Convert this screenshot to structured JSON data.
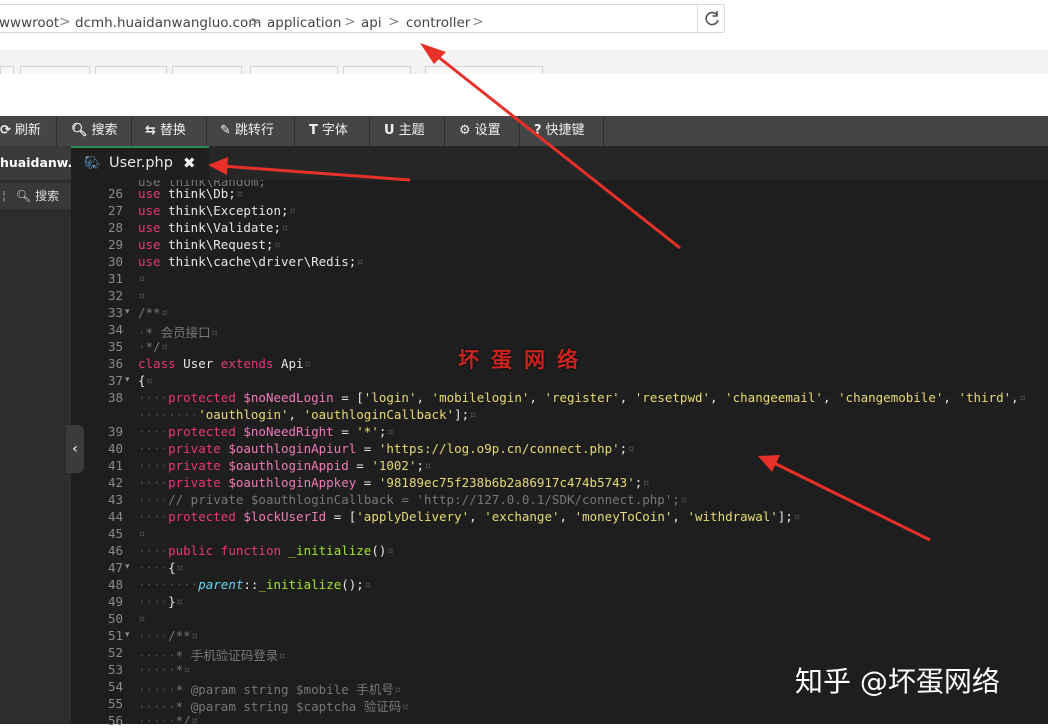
{
  "breadcrumb": {
    "items": [
      "wwwroot",
      "dcmh.huaidanwangluo.com",
      "application",
      "api",
      "controller"
    ],
    "separator": ">"
  },
  "toolbar": {
    "items": [
      {
        "icon": "refresh-icon",
        "label": "刷新"
      },
      {
        "icon": "search-icon",
        "label": "搜索"
      },
      {
        "icon": "replace-icon",
        "label": "替换"
      },
      {
        "icon": "pin-icon",
        "label": "跳转行"
      },
      {
        "icon": "font-icon",
        "label": "字体"
      },
      {
        "icon": "theme-icon",
        "label": "主题"
      },
      {
        "icon": "gear-icon",
        "label": "设置"
      },
      {
        "icon": "help-icon",
        "label": "快捷键"
      }
    ]
  },
  "sidebar": {
    "tab_label": "huaidanw...",
    "search_label": "搜索"
  },
  "editor": {
    "file_tab": "User.php",
    "lines": [
      {
        "n": "26",
        "text": "use think\\Db;"
      },
      {
        "n": "27",
        "text": "use think\\Exception;"
      },
      {
        "n": "28",
        "text": "use think\\Validate;"
      },
      {
        "n": "29",
        "text": "use think\\Request;"
      },
      {
        "n": "30",
        "text": "use think\\cache\\driver\\Redis;"
      },
      {
        "n": "31",
        "text": ""
      },
      {
        "n": "32",
        "text": ""
      },
      {
        "n": "33",
        "text": "/**"
      },
      {
        "n": "34",
        "text": " * 会员接口"
      },
      {
        "n": "35",
        "text": " */"
      },
      {
        "n": "36",
        "text": "class User extends Api"
      },
      {
        "n": "37",
        "text": "{"
      },
      {
        "n": "38",
        "text": "    protected $noNeedLogin = ['login', 'mobilelogin', 'register', 'resetpwd', 'changeemail', 'changemobile', 'third',"
      },
      {
        "n": "",
        "text": "        'oauthlogin', 'oauthloginCallback'];"
      },
      {
        "n": "39",
        "text": "    protected $noNeedRight = '*';"
      },
      {
        "n": "40",
        "text": "    private $oauthloginApiurl = 'https://log.o9p.cn/connect.php';"
      },
      {
        "n": "41",
        "text": "    private $oauthloginAppid = '1002';"
      },
      {
        "n": "42",
        "text": "    private $oauthloginAppkey = '98189ec75f238b6b2a86917c474b5743';"
      },
      {
        "n": "43",
        "text": "    // private $oauthloginCallback = 'http://127.0.0.1/SDK/connect.php';"
      },
      {
        "n": "44",
        "text": "    protected $lockUserId = ['applyDelivery', 'exchange', 'moneyToCoin', 'withdrawal'];"
      },
      {
        "n": "45",
        "text": ""
      },
      {
        "n": "46",
        "text": "    public function _initialize()"
      },
      {
        "n": "47",
        "text": "    {"
      },
      {
        "n": "48",
        "text": "        parent::_initialize();"
      },
      {
        "n": "49",
        "text": "    }"
      },
      {
        "n": "50",
        "text": ""
      },
      {
        "n": "51",
        "text": "    /**"
      },
      {
        "n": "52",
        "text": "     * 手机验证码登录"
      },
      {
        "n": "53",
        "text": "     *"
      },
      {
        "n": "54",
        "text": "     * @param string $mobile 手机号"
      },
      {
        "n": "55",
        "text": "     * @param string $captcha 验证码"
      },
      {
        "n": "56",
        "text": "     */"
      }
    ]
  },
  "watermarks": {
    "red": "坏蛋网络",
    "zhihu": "知乎 @坏蛋网络"
  },
  "colors": {
    "toolbar_bg": "#454545",
    "editor_bg": "#1e1e1e",
    "keyword": "#e8367a",
    "string": "#e6db74",
    "comment": "#777777",
    "arrow": "#e8302a"
  }
}
